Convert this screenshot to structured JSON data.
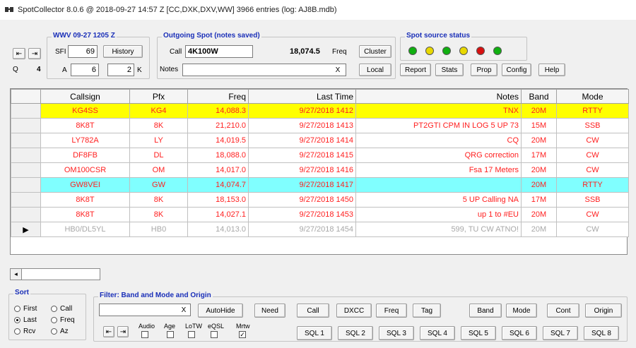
{
  "window": {
    "title": "SpotCollector 8.0.6 @ 2018-09-27  14:57 Z [CC,DXK,DXV,WW] 3966 entries (log: AJ8B.mdb)"
  },
  "wwv": {
    "title": "WWV 09-27 1205 Z",
    "sfi_label": "SFI",
    "sfi": "69",
    "history_label": "History",
    "a_label": "A",
    "a": "6",
    "k": "2",
    "k_label": "K",
    "q_label": "Q",
    "q": "4"
  },
  "outgoing": {
    "title": "Outgoing Spot (notes saved)",
    "call_label": "Call",
    "call": "4K100W",
    "freq": "18,074.5",
    "freq_label": "Freq",
    "notes_label": "Notes",
    "notes": "",
    "cluster_label": "Cluster",
    "local_label": "Local",
    "clear_glyph": "X"
  },
  "spot_source": {
    "title": "Spot source status",
    "leds": [
      "#10b010",
      "#e8d800",
      "#10b010",
      "#e8d800",
      "#d81010",
      "#10b010"
    ],
    "buttons": [
      "Report",
      "Stats",
      "Prop",
      "Config",
      "Help"
    ]
  },
  "grid": {
    "columns": [
      "Callsign",
      "Pfx",
      "Freq",
      "Last Time",
      "Notes",
      "Band",
      "Mode"
    ],
    "rows": [
      {
        "callsign": "KG4SS",
        "pfx": "KG4",
        "freq": "14,088.3",
        "time": "9/27/2018 1412",
        "notes": "TNX",
        "band": "20M",
        "mode": "RTTY",
        "bg": "#ffff00",
        "fg": "#ff2020"
      },
      {
        "callsign": "8K8T",
        "pfx": "8K",
        "freq": "21,210.0",
        "time": "9/27/2018 1413",
        "notes": "PT2GTI CPM IN LOG 5 UP 73",
        "band": "15M",
        "mode": "SSB",
        "bg": "#ffffff",
        "fg": "#ff2020"
      },
      {
        "callsign": "LY782A",
        "pfx": "LY",
        "freq": "14,019.5",
        "time": "9/27/2018 1414",
        "notes": "CQ",
        "band": "20M",
        "mode": "CW",
        "bg": "#ffffff",
        "fg": "#ff2020"
      },
      {
        "callsign": "DF8FB",
        "pfx": "DL",
        "freq": "18,088.0",
        "time": "9/27/2018 1415",
        "notes": "QRG correction",
        "band": "17M",
        "mode": "CW",
        "bg": "#ffffff",
        "fg": "#ff2020"
      },
      {
        "callsign": "OM100CSR",
        "pfx": "OM",
        "freq": "14,017.0",
        "time": "9/27/2018 1416",
        "notes": "Fsa 17 Meters",
        "band": "20M",
        "mode": "CW",
        "bg": "#ffffff",
        "fg": "#ff2020"
      },
      {
        "callsign": "GW8VEI",
        "pfx": "GW",
        "freq": "14,074.7",
        "time": "9/27/2018 1417",
        "notes": "",
        "band": "20M",
        "mode": "RTTY",
        "bg": "#80ffff",
        "fg": "#ff2020"
      },
      {
        "callsign": "8K8T",
        "pfx": "8K",
        "freq": "18,153.0",
        "time": "9/27/2018 1450",
        "notes": "5 UP Calling NA",
        "band": "17M",
        "mode": "SSB",
        "bg": "#ffffff",
        "fg": "#ff2020"
      },
      {
        "callsign": "8K8T",
        "pfx": "8K",
        "freq": "14,027.1",
        "time": "9/27/2018 1453",
        "notes": "up 1 to #EU",
        "band": "20M",
        "mode": "CW",
        "bg": "#ffffff",
        "fg": "#ff2020"
      },
      {
        "callsign": "HB0/DL5YL",
        "pfx": "HB0",
        "freq": "14,013.0",
        "time": "9/27/2018 1454",
        "notes": "599, TU CW ATNO!",
        "band": "20M",
        "mode": "CW",
        "bg": "#ffffff",
        "fg": "#a8a8a8"
      }
    ],
    "current_row_marker": "▶"
  },
  "sort": {
    "title": "Sort",
    "options": [
      "First",
      "Call",
      "Last",
      "Freq",
      "Rcv",
      "Az"
    ],
    "selected": "Last"
  },
  "filter": {
    "title": "Filter: Band and Mode and Origin",
    "autohide_label": "AutoHide",
    "need_label": "Need",
    "clear_glyph": "X",
    "buttons_row1": [
      "Call",
      "DXCC",
      "Freq",
      "Tag",
      "Band",
      "Mode",
      "Cont",
      "Origin"
    ],
    "buttons_row2": [
      "SQL 1",
      "SQL 2",
      "SQL 3",
      "SQL 4",
      "SQL 5",
      "SQL 6",
      "SQL 7",
      "SQL 8"
    ],
    "check_labels": [
      "Audio",
      "Age",
      "LoTW",
      "eQSL",
      "Mrtw"
    ]
  }
}
